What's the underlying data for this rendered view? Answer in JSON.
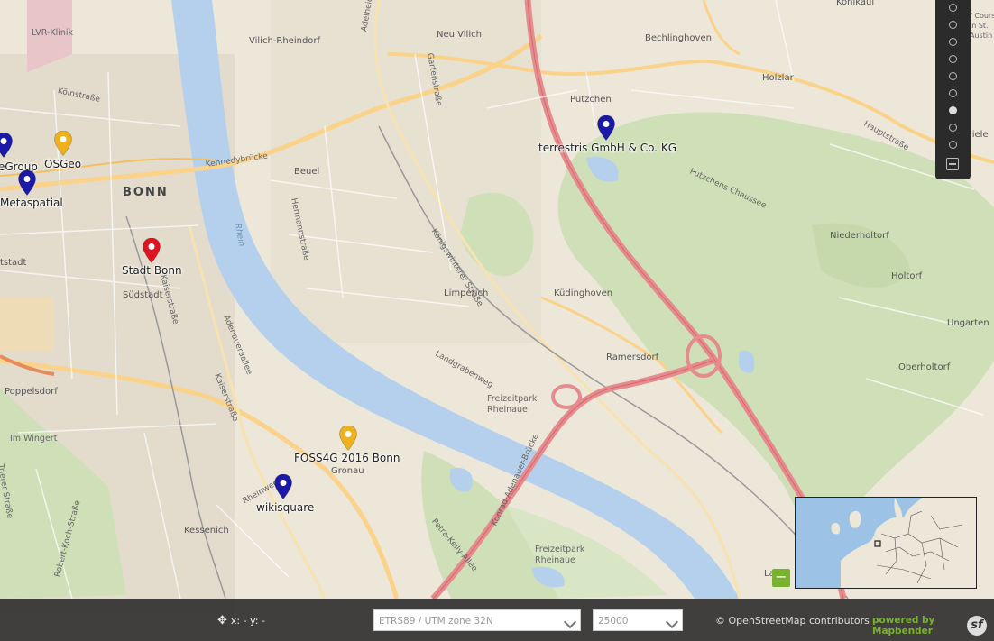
{
  "map": {
    "places": {
      "vilich_rheindorf": "Vilich-Rheindorf",
      "neu_vilich": "Neu Vilich",
      "bechlinghoven": "Bechlinghoven",
      "kohlkaul": "Kohlkaul",
      "holzlar": "Holzlar",
      "putzchen": "Putzchen",
      "beuel": "Beuel",
      "bonn": "BONN",
      "suedstadt": "Südstadt",
      "poppelsdorf": "Poppelsdorf",
      "im_wingert": "Im Wingert",
      "kessenich": "Kessenich",
      "gronau": "Gronau",
      "limperich": "Limperich",
      "kuedinghoven": "Küdinghoven",
      "ramersdorf": "Ramersdorf",
      "niederholtorf": "Niederholtorf",
      "holtorf": "Holtorf",
      "oberholtorf": "Oberholtorf",
      "ungarten": "Ungarten",
      "freizeitpark_1": "Freizeitpark\nRheinaue",
      "freizeitpark_2": "Freizeitpark\nRheinaue",
      "lvr_klinik": "LVR-Klinik",
      "stadt_left": "tstadt",
      "giele": "Giele",
      "golf": "f Course\nin St.\nAustin",
      "l_frag": "La"
    },
    "streets": {
      "koelnstrasse": "Kölnstraße",
      "kennedybruecke": "Kennedybrücke",
      "hermannstrasse": "Hermannstraße",
      "gartenstrasse": "Gartenstraße",
      "adelheid": "Adelheidis",
      "rhein": "Rhein",
      "koenigswinterer": "Königswinterer Straße",
      "kaiserstrasse": "Kaiserstraße",
      "adenauerallee": "Adenaueraallee",
      "kaiserstrasse2": "Kaiserstraße",
      "landgrabenweg": "Landgrabenweg",
      "hauptstrasse": "Hauptstraße",
      "putzchens": "Putzchens Chaussee",
      "konrad": "Konrad-Adenauer-Brücke",
      "petra": "Petra-Kelly-Allee",
      "robert": "Robert-Koch-Straße",
      "trierer": "Trierer Straße",
      "rheinweg": "Rheinweg"
    },
    "markers": [
      {
        "label": "terrestris GmbH & Co. KG",
        "color": "#1a1aa6"
      },
      {
        "label": "OSGeo",
        "color": "#f0b21c"
      },
      {
        "label": "eGroup",
        "color": "#1a1aa6"
      },
      {
        "label": "Metaspatial",
        "color": "#1a1aa6"
      },
      {
        "label": "Stadt Bonn",
        "color": "#e0141e"
      },
      {
        "label": "FOSS4G 2016 Bonn",
        "color": "#f0b21c"
      },
      {
        "label": "wikisquare",
        "color": "#1a1aa6"
      }
    ]
  },
  "zoom": {
    "steps": 9,
    "active_index": 6
  },
  "overview": {
    "toggle_label": "−"
  },
  "footer": {
    "coords_label": "x: - y: -",
    "crs": "ETRS89 / UTM zone 32N",
    "scale": "25000",
    "attribution": "© OpenStreetMap contributors",
    "powered": "powered by Mapbender",
    "logo_letter": "sf"
  },
  "colors": {
    "land": "#ece7d8",
    "water": "#b5d0ec",
    "forest": "#cfe0b8",
    "motorway": "#e58c8f",
    "primary": "#fbd28a",
    "footer_bg": "#282828",
    "accent": "#79b22e"
  }
}
